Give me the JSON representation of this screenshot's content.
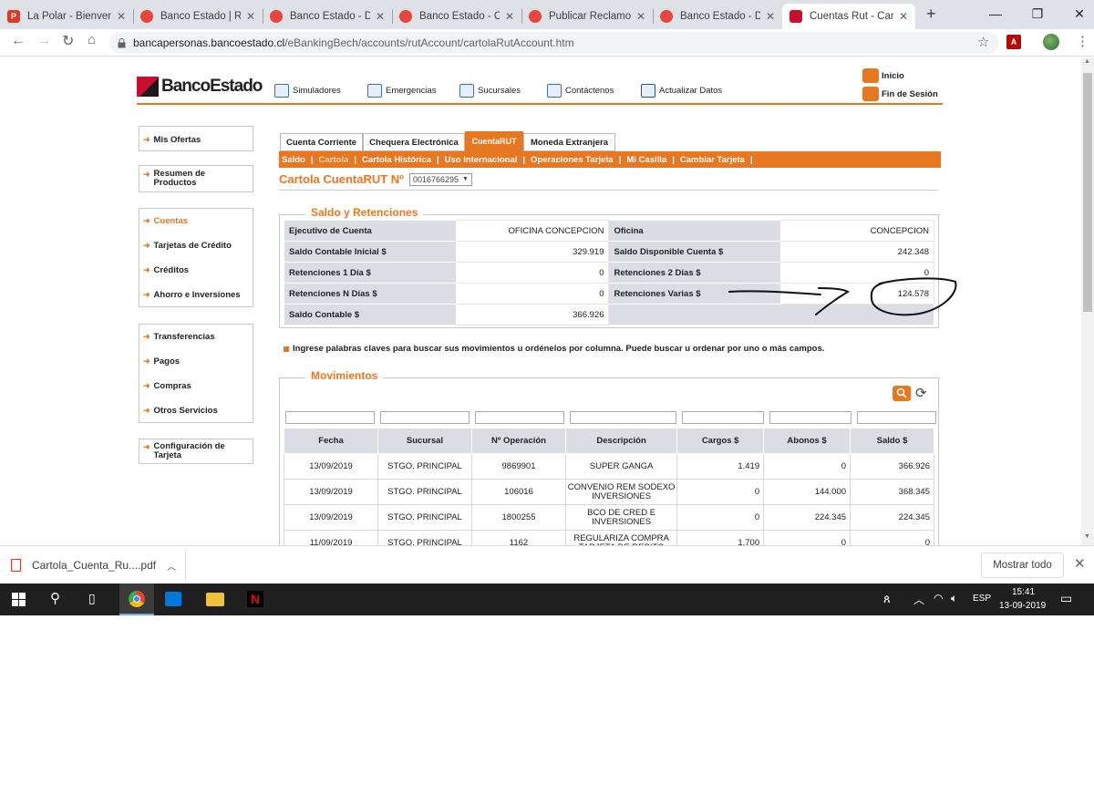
{
  "browser": {
    "tabs": [
      {
        "title": "La Polar - Bienven",
        "favicon_color": "#d83b28",
        "favicon_letter": "P"
      },
      {
        "title": "Banco Estado | Re",
        "favicon_color": "#e8453c",
        "favicon_letter": ""
      },
      {
        "title": "Banco Estado - De",
        "favicon_color": "#e8453c",
        "favicon_letter": ""
      },
      {
        "title": "Banco Estado - Co",
        "favicon_color": "#e8453c",
        "favicon_letter": ""
      },
      {
        "title": "Publicar Reclamo |",
        "favicon_color": "#e8453c",
        "favicon_letter": ""
      },
      {
        "title": "Banco Estado - Du",
        "favicon_color": "#e8453c",
        "favicon_letter": ""
      },
      {
        "title": "Cuentas Rut - Cart",
        "favicon_color": "#c8102e",
        "favicon_letter": ""
      }
    ],
    "new_tab": "+",
    "url_host": "bancapersonas.bancoestado.cl",
    "url_path": "/eBankingBech/accounts/rutAccount/cartolaRutAccount.htm"
  },
  "site": {
    "logo_text": "BancoEstado",
    "header_links": [
      {
        "label": "Simuladores",
        "icon": "calculator-icon"
      },
      {
        "label": "Emergencias",
        "icon": "emergency-icon"
      },
      {
        "label": "Sucursales",
        "icon": "map-icon"
      },
      {
        "label": "Contáctenos",
        "icon": "mail-icon"
      },
      {
        "label": "Actualizar Datos",
        "icon": "refresh-icon"
      }
    ],
    "inicio": "Inicio",
    "fin_sesion": "Fin de Sesión"
  },
  "sidebar": {
    "box1": [
      "Mis Ofertas"
    ],
    "box2": [
      "Resumen de Productos"
    ],
    "box3": [
      "Cuentas",
      "Tarjetas de Crédito",
      "Créditos",
      "Ahorro e Inversiones"
    ],
    "box4": [
      "Transferencias",
      "Pagos",
      "Compras",
      "Otros Servicios"
    ],
    "box5": [
      "Configuración de Tarjeta"
    ]
  },
  "main": {
    "tabs": [
      "Cuenta Corriente",
      "Chequera Electrónica",
      "CuentaRUT",
      "Moneda Extranjera"
    ],
    "subnav": [
      "Saldo",
      "Cartola",
      "Cartola Histórica",
      "Uso Internacional",
      "Operaciones Tarjeta",
      "Mi Casilla",
      "Cambiar Tarjeta"
    ],
    "title": "Cartola CuentaRUT Nº",
    "account_number": "0016766295",
    "saldo_section_title": "Saldo y Retenciones",
    "saldo": {
      "ejecutivo_label": "Ejecutivo de Cuenta",
      "ejecutivo_value": "OFICINA CONCEPCION",
      "oficina_label": "Oficina",
      "oficina_value": "CONCEPCION",
      "sci_label": "Saldo Contable Inicial $",
      "sci_value": "329.919",
      "sdc_label": "Saldo Disponible Cuenta $",
      "sdc_value": "242.348",
      "r1_label": "Retenciones 1 Día $",
      "r1_value": "0",
      "r2_label": "Retenciones 2 Días $",
      "r2_value": "0",
      "rn_label": "Retenciones N Días $",
      "rn_value": "0",
      "rv_label": "Retenciones Varias $",
      "rv_value": "124.578",
      "sc_label": "Saldo Contable $",
      "sc_value": "366.926"
    },
    "hint": "Ingrese palabras claves para buscar sus movimientos u ordénelos por columna. Puede buscar u ordenar por uno o más campos.",
    "mov_section_title": "Movimientos",
    "mov_columns": [
      "Fecha",
      "Sucursal",
      "Nº Operación",
      "Descripción",
      "Cargos $",
      "Abonos $",
      "Saldo $"
    ],
    "mov_rows": [
      [
        "13/09/2019",
        "STGO. PRINCIPAL",
        "9869901",
        "SUPER GANGA",
        "1.419",
        "0",
        "366.926"
      ],
      [
        "13/09/2019",
        "STGO. PRINCIPAL",
        "106016",
        "CONVENIO REM SODEXO INVERSIONES",
        "0",
        "144.000",
        "368.345"
      ],
      [
        "13/09/2019",
        "STGO. PRINCIPAL",
        "1800255",
        "BCO DE CRED E INVERSIONES",
        "0",
        "224.345",
        "224.345"
      ],
      [
        "11/09/2019",
        "STGO. PRINCIPAL",
        "1162",
        "REGULARIZA COMPRA TARJETA DE DEBITO",
        "1.700",
        "0",
        "0"
      ]
    ]
  },
  "download_bar": {
    "file": "Cartola_Cuenta_Ru....pdf",
    "show_all": "Mostrar todo"
  },
  "taskbar": {
    "lang": "ESP",
    "time": "15:41",
    "date": "13-09-2019"
  },
  "colors": {
    "accent": "#e87722",
    "brand_red": "#c8102e",
    "label_bg": "#dcdce4"
  }
}
